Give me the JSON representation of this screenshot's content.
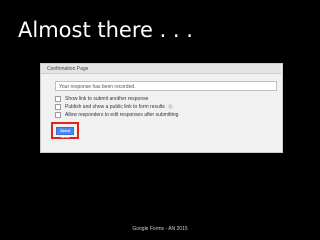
{
  "slide": {
    "title": "Almost there . . .",
    "footer": "Google Forms - AN 2015"
  },
  "panel": {
    "header": "Confirmation Page",
    "response_message": "Your response has been recorded.",
    "options": [
      {
        "label": "Show link to submit another response",
        "checked": false
      },
      {
        "label": "Publish and show a public link to form results",
        "checked": false
      },
      {
        "label": "Allow responders to edit responses after submitting",
        "checked": false
      }
    ],
    "help_icon_text": "?",
    "send_button_label": "Send form"
  },
  "colors": {
    "background": "#000000",
    "highlight": "#e2231a",
    "button": "#4a8af4"
  }
}
